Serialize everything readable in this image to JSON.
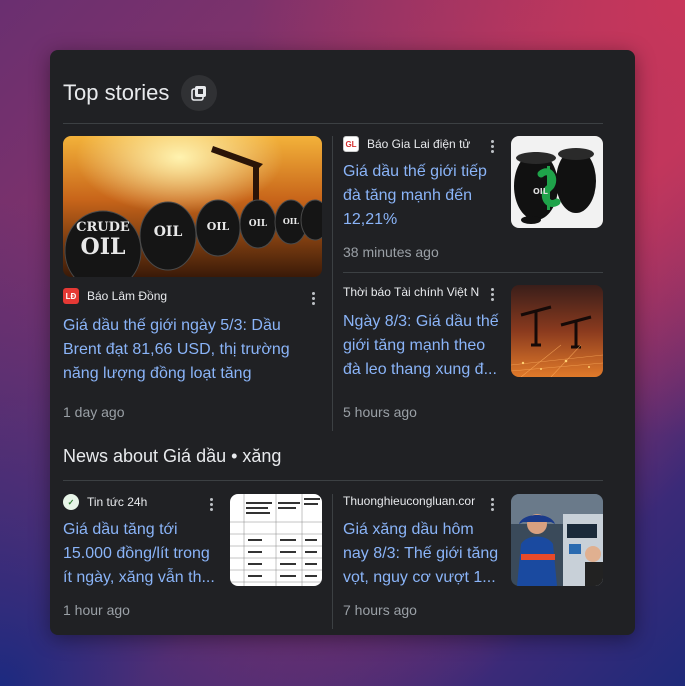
{
  "top_stories": {
    "title": "Top stories",
    "more_icon": "view-collection-icon",
    "stories": [
      {
        "source": "Báo Lâm Đồng",
        "favicon_text": "LĐ",
        "headline": "Giá dầu thế giới ngày 5/3: Dầu Brent đạt 81,66 USD, thị trường năng lượng đồng loạt tăng",
        "time": "1 day ago",
        "image": "crude-oil-barrels-image",
        "image_text": [
          "CRUDE",
          "OIL"
        ]
      },
      {
        "source": "Báo Gia Lai điện tử",
        "favicon_text": "GL",
        "headline": "Giá dầu thế giới tiếp đà tăng mạnh đến 12,21%",
        "time": "38 minutes ago",
        "image": "oil-barrels-dollar-image",
        "image_text": [
          "OIL"
        ]
      },
      {
        "source": "Thời báo Tài chính Việt N",
        "favicon_text": "",
        "headline": "Ngày 8/3: Giá dầu thế giới tăng mạnh theo đà leo thang xung đ...",
        "time": "5 hours ago",
        "image": "oil-pumpjacks-image"
      }
    ]
  },
  "news_about": {
    "title": "News about Giá dầu • xăng",
    "stories": [
      {
        "source": "Tin tức 24h",
        "favicon_text": "",
        "headline": "Giá dầu tăng tới 15.000 đồng/lít trong ít ngày, xăng vẫn th...",
        "time": "1 hour ago",
        "image": "fuel-price-table-image"
      },
      {
        "source": "Thuonghieucongluan.cor",
        "favicon_text": "",
        "headline": "Giá xăng dầu hôm nay 8/3: Thế giới tăng vọt, nguy cơ vượt 1...",
        "time": "7 hours ago",
        "image": "gas-station-worker-image"
      }
    ]
  },
  "colors": {
    "card": "#202124",
    "link": "#8ab4f8",
    "muted": "#9aa0a6"
  }
}
